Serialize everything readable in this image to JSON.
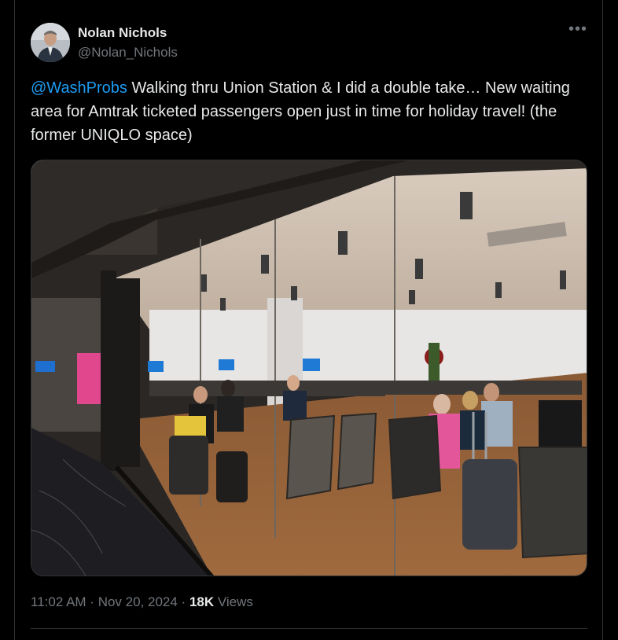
{
  "author": {
    "display_name": "Nolan Nichols",
    "handle": "@Nolan_Nichols"
  },
  "more_icon": "more-horizontal-icon",
  "tweet": {
    "mention": "@WashProbs",
    "text": " Walking thru Union Station & I did a double take… New waiting area for Amtrak ticketed passengers open just in time for holiday travel! (the former UNIQLO space)"
  },
  "media": {
    "icon": "photo"
  },
  "meta": {
    "time": "11:02 AM",
    "sep1": " · ",
    "date": "Nov 20, 2024",
    "sep2": " · ",
    "views_count": "18K",
    "views_label": " Views"
  },
  "colors": {
    "background": "#000000",
    "text": "#e7e9ea",
    "secondary": "#71767b",
    "link": "#1d9bf0",
    "border": "#2f3336"
  }
}
